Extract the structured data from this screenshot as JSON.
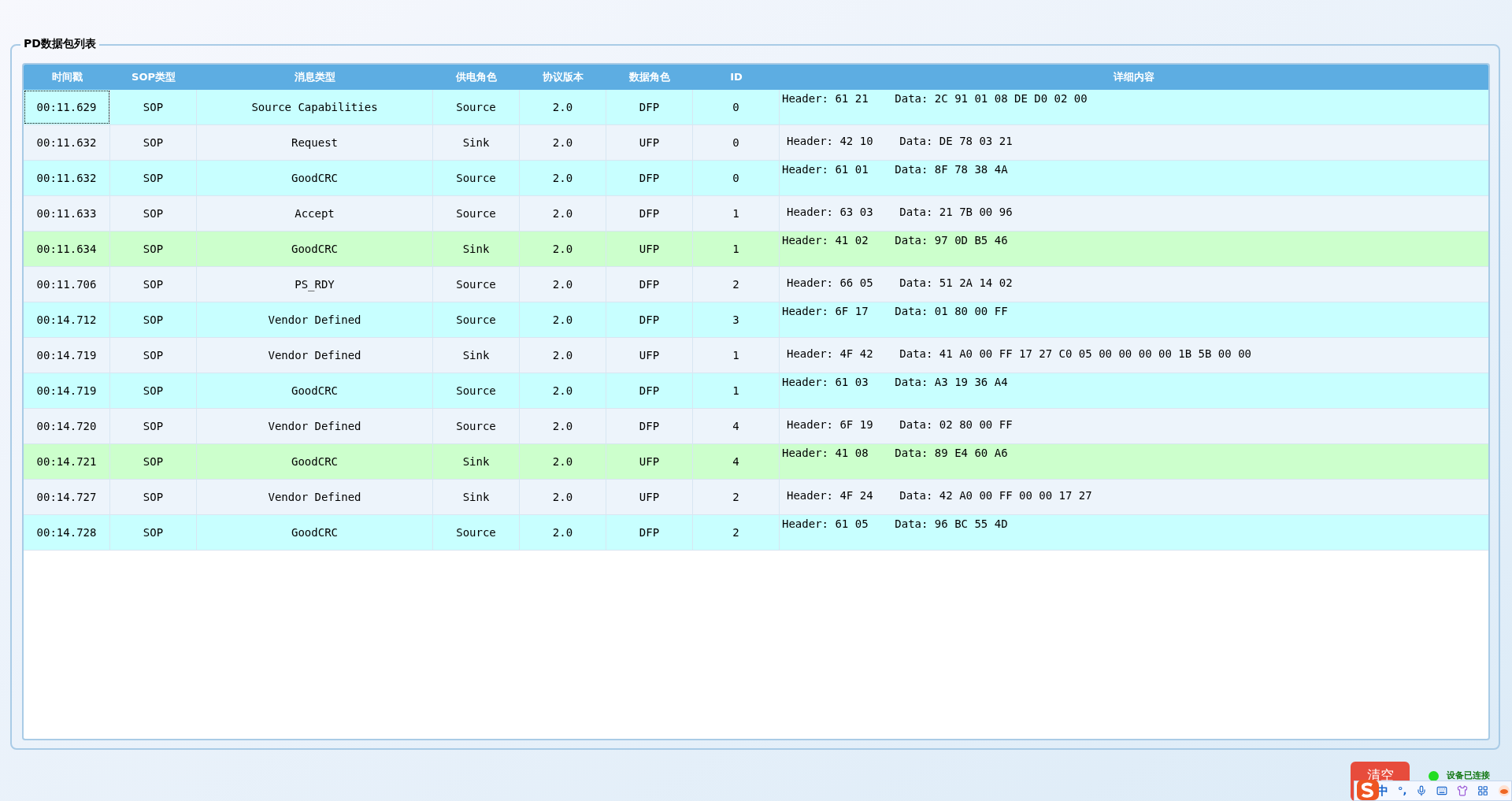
{
  "panel": {
    "title": "PD数据包列表"
  },
  "table": {
    "columns": [
      "时间戳",
      "SOP类型",
      "消息类型",
      "供电角色",
      "协议版本",
      "数据角色",
      "ID",
      "详细内容"
    ],
    "rows": [
      {
        "selected": true,
        "color": "#c8ffff",
        "cells": [
          "00:11.629",
          "SOP",
          "Source Capabilities",
          "Source",
          "2.0",
          "DFP",
          "0",
          "Header: 61 21    Data: 2C 91 01 08 DE D0 02 00"
        ]
      },
      {
        "selected": false,
        "color": "#edf4fb",
        "cells": [
          "00:11.632",
          "SOP",
          "Request",
          "Sink",
          "2.0",
          "UFP",
          "0",
          "Header: 42 10    Data: DE 78 03 21"
        ]
      },
      {
        "selected": false,
        "color": "#c8ffff",
        "cells": [
          "00:11.632",
          "SOP",
          "GoodCRC",
          "Source",
          "2.0",
          "DFP",
          "0",
          "Header: 61 01    Data: 8F 78 38 4A"
        ]
      },
      {
        "selected": false,
        "color": "#edf4fb",
        "cells": [
          "00:11.633",
          "SOP",
          "Accept",
          "Source",
          "2.0",
          "DFP",
          "1",
          "Header: 63 03    Data: 21 7B 00 96"
        ]
      },
      {
        "selected": false,
        "color": "#ccffcc",
        "cells": [
          "00:11.634",
          "SOP",
          "GoodCRC",
          "Sink",
          "2.0",
          "UFP",
          "1",
          "Header: 41 02    Data: 97 0D B5 46"
        ]
      },
      {
        "selected": false,
        "color": "#edf4fb",
        "cells": [
          "00:11.706",
          "SOP",
          "PS_RDY",
          "Source",
          "2.0",
          "DFP",
          "2",
          "Header: 66 05    Data: 51 2A 14 02"
        ]
      },
      {
        "selected": false,
        "color": "#c8ffff",
        "cells": [
          "00:14.712",
          "SOP",
          "Vendor Defined",
          "Source",
          "2.0",
          "DFP",
          "3",
          "Header: 6F 17    Data: 01 80 00 FF"
        ]
      },
      {
        "selected": false,
        "color": "#edf4fb",
        "cells": [
          "00:14.719",
          "SOP",
          "Vendor Defined",
          "Sink",
          "2.0",
          "UFP",
          "1",
          "Header: 4F 42    Data: 41 A0 00 FF 17 27 C0 05 00 00 00 00 1B 5B 00 00"
        ]
      },
      {
        "selected": false,
        "color": "#c8ffff",
        "cells": [
          "00:14.719",
          "SOP",
          "GoodCRC",
          "Source",
          "2.0",
          "DFP",
          "1",
          "Header: 61 03    Data: A3 19 36 A4"
        ]
      },
      {
        "selected": false,
        "color": "#edf4fb",
        "cells": [
          "00:14.720",
          "SOP",
          "Vendor Defined",
          "Source",
          "2.0",
          "DFP",
          "4",
          "Header: 6F 19    Data: 02 80 00 FF"
        ]
      },
      {
        "selected": false,
        "color": "#ccffcc",
        "cells": [
          "00:14.721",
          "SOP",
          "GoodCRC",
          "Sink",
          "2.0",
          "UFP",
          "4",
          "Header: 41 08    Data: 89 E4 60 A6"
        ]
      },
      {
        "selected": false,
        "color": "#edf4fb",
        "cells": [
          "00:14.727",
          "SOP",
          "Vendor Defined",
          "Sink",
          "2.0",
          "UFP",
          "2",
          "Header: 4F 24    Data: 42 A0 00 FF 00 00 17 27"
        ]
      },
      {
        "selected": false,
        "color": "#c8ffff",
        "cells": [
          "00:14.728",
          "SOP",
          "GoodCRC",
          "Source",
          "2.0",
          "DFP",
          "2",
          "Header: 61 05    Data: 96 BC 55 4D"
        ]
      }
    ]
  },
  "clear_button": "清空",
  "status": {
    "connected": true,
    "label": "设备已连接"
  },
  "ime_toolbar": {
    "mode": "中",
    "punctuation": "°,"
  }
}
